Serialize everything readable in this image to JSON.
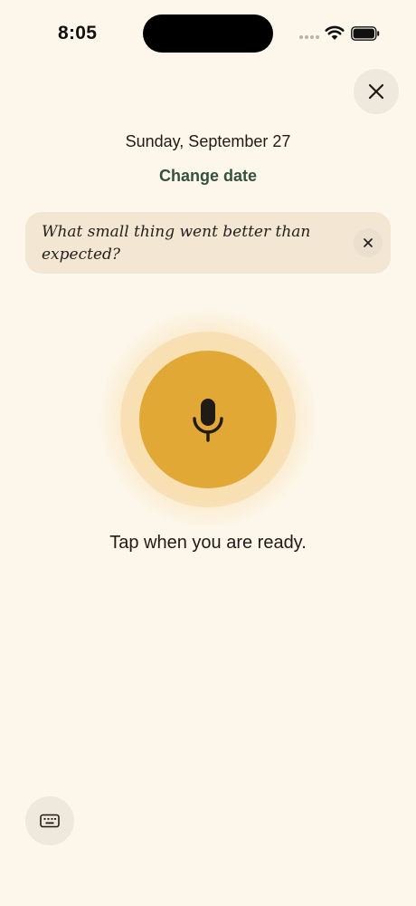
{
  "status_bar": {
    "time": "8:05"
  },
  "header": {
    "close_icon": "close-icon",
    "date": "Sunday, September 27",
    "change_date_label": "Change date"
  },
  "prompt": {
    "text": "What small thing went better than expected?",
    "dismiss_icon": "close-icon"
  },
  "recorder": {
    "mic_icon": "microphone-icon",
    "hint": "Tap when you are ready.",
    "accent_color": "#e2a836"
  },
  "footer": {
    "keyboard_icon": "keyboard-icon"
  },
  "colors": {
    "background": "#fdf6ea",
    "link": "#34503f",
    "card": "#f3e6d3"
  }
}
